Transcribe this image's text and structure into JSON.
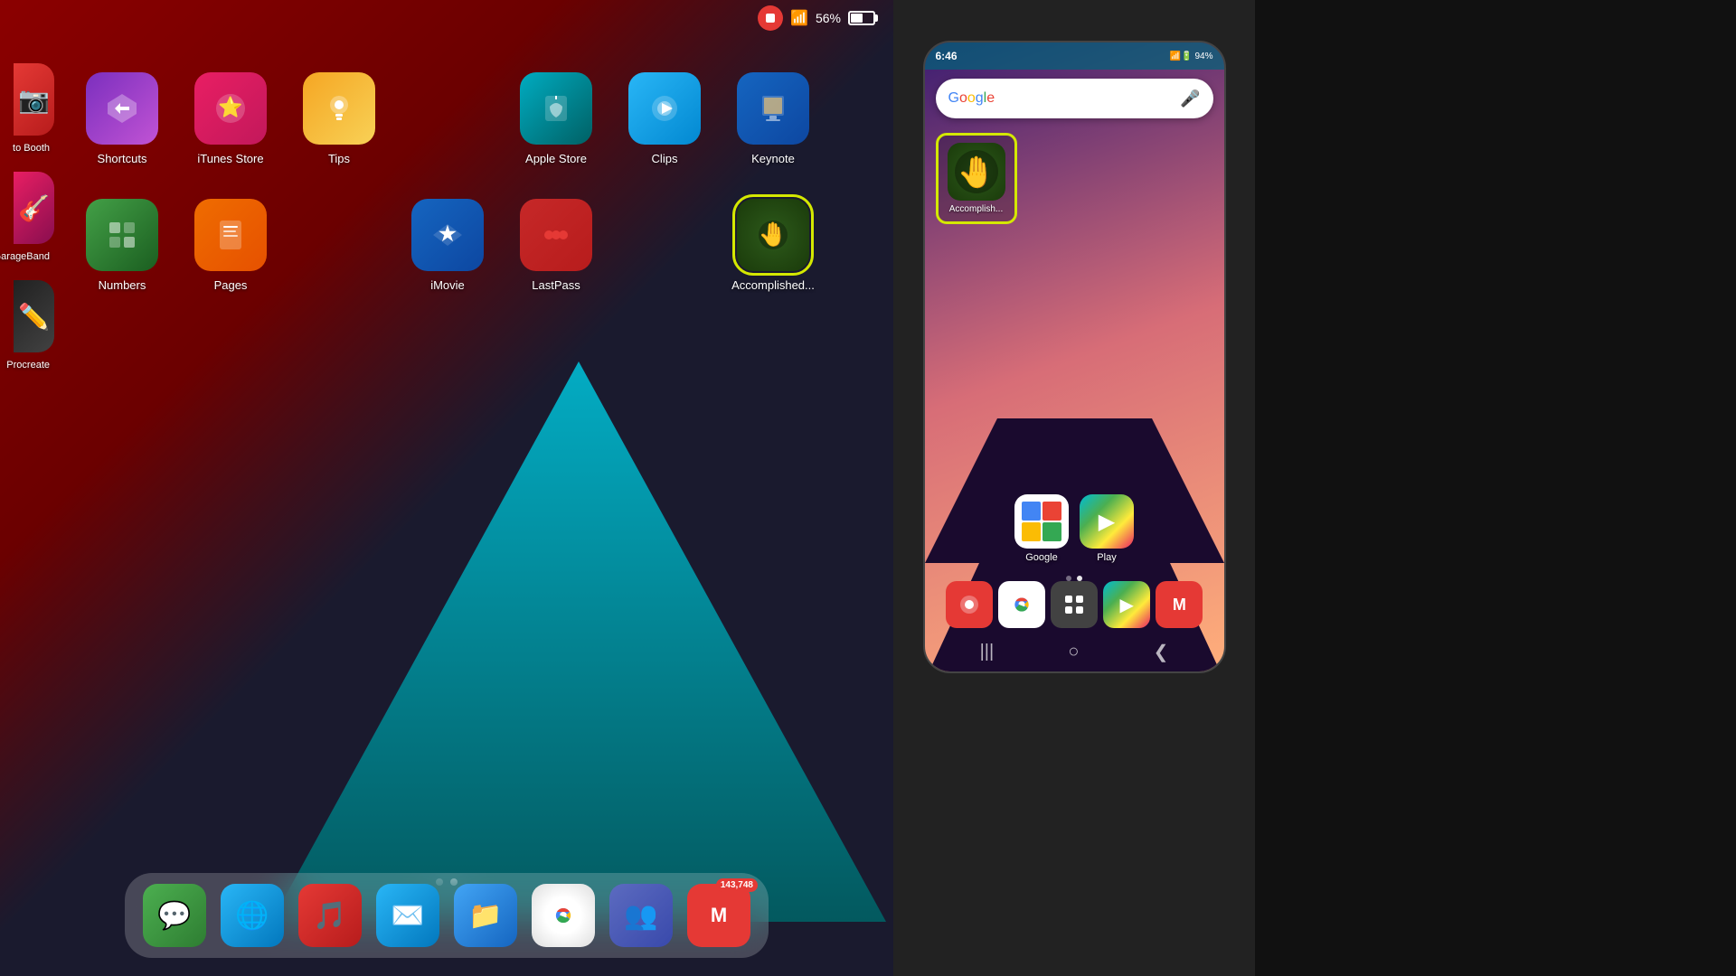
{
  "ipad": {
    "statusbar": {
      "battery_percent": "56%",
      "wifi": "wifi"
    },
    "apps": [
      {
        "id": "photo-booth",
        "label": "to Booth",
        "bg": "bg-red",
        "emoji": "📷",
        "partial": true
      },
      {
        "id": "shortcuts",
        "label": "Shortcuts",
        "bg": "bg-purple",
        "emoji": "✂️"
      },
      {
        "id": "itunes-store",
        "label": "iTunes Store",
        "bg": "bg-pink-red",
        "emoji": "⭐"
      },
      {
        "id": "tips",
        "label": "Tips",
        "bg": "bg-yellow",
        "emoji": "💡"
      },
      {
        "id": "apple-store",
        "label": "Apple Store",
        "bg": "bg-teal",
        "emoji": "🛍️"
      },
      {
        "id": "clips",
        "label": "Clips",
        "bg": "bg-blue-light",
        "emoji": "🎬"
      },
      {
        "id": "keynote",
        "label": "Keynote",
        "bg": "bg-dark-blue",
        "emoji": "📊"
      },
      {
        "id": "numbers",
        "label": "Numbers",
        "bg": "bg-green",
        "emoji": "🔢"
      },
      {
        "id": "pages",
        "label": "Pages",
        "bg": "bg-orange",
        "emoji": "📝"
      },
      {
        "id": "imovie",
        "label": "iMovie",
        "bg": "bg-dark-blue",
        "emoji": "⭐"
      },
      {
        "id": "lastpass",
        "label": "LastPass",
        "bg": "bg-red",
        "emoji": "🔴"
      },
      {
        "id": "garageband",
        "label": "GarageBand",
        "partial": true,
        "emoji": "🎸"
      },
      {
        "id": "procreate",
        "label": "Procreate",
        "partial": true,
        "emoji": "🎨"
      },
      {
        "id": "accomplished",
        "label": "Accomplished...",
        "highlighted": true,
        "bg": "bg-accomplished",
        "emoji": "🤚"
      }
    ],
    "dock": [
      {
        "id": "messages",
        "label": "Messages",
        "bg": "bg-green",
        "emoji": "💬"
      },
      {
        "id": "safari",
        "label": "Safari",
        "bg": "bg-blue-light",
        "emoji": "🌐"
      },
      {
        "id": "music",
        "label": "Music",
        "bg": "bg-red",
        "emoji": "🎵"
      },
      {
        "id": "mail",
        "label": "Mail",
        "bg": "bg-blue-light",
        "emoji": "✉️"
      },
      {
        "id": "files",
        "label": "Files",
        "bg": "bg-blue-light",
        "emoji": "📁"
      },
      {
        "id": "chrome",
        "label": "Chrome",
        "bg": "bg-silver",
        "emoji": "🌐"
      },
      {
        "id": "teams",
        "label": "Teams",
        "bg": "bg-dark-purple",
        "emoji": "👥"
      },
      {
        "id": "gmail",
        "label": "Gmail",
        "bg": "bg-red",
        "emoji": "✉️",
        "badge": "143,748"
      }
    ],
    "page_dots": [
      false,
      true
    ]
  },
  "phone": {
    "statusbar": {
      "time": "6:46",
      "battery": "94%"
    },
    "google_bar": {
      "placeholder": ""
    },
    "home_apps": [
      {
        "id": "google",
        "label": "Google",
        "emoji": "G"
      },
      {
        "id": "play",
        "label": "Play",
        "emoji": "▶"
      }
    ],
    "dock_apps": [
      {
        "id": "record",
        "emoji": "📹",
        "bg": "#e53935"
      },
      {
        "id": "chrome",
        "emoji": "🌐",
        "bg": "#fff"
      },
      {
        "id": "launcher",
        "emoji": "⋮⋮⋮",
        "bg": "#424242"
      },
      {
        "id": "play-store",
        "emoji": "▶",
        "bg": "#fff"
      },
      {
        "id": "gmail",
        "emoji": "M",
        "bg": "#e53935"
      }
    ],
    "accomplished_app": {
      "label": "Accomplish..."
    },
    "page_dots": [
      false,
      true
    ],
    "navbar": {
      "back": "❮",
      "home": "○",
      "recents": "|||"
    }
  }
}
